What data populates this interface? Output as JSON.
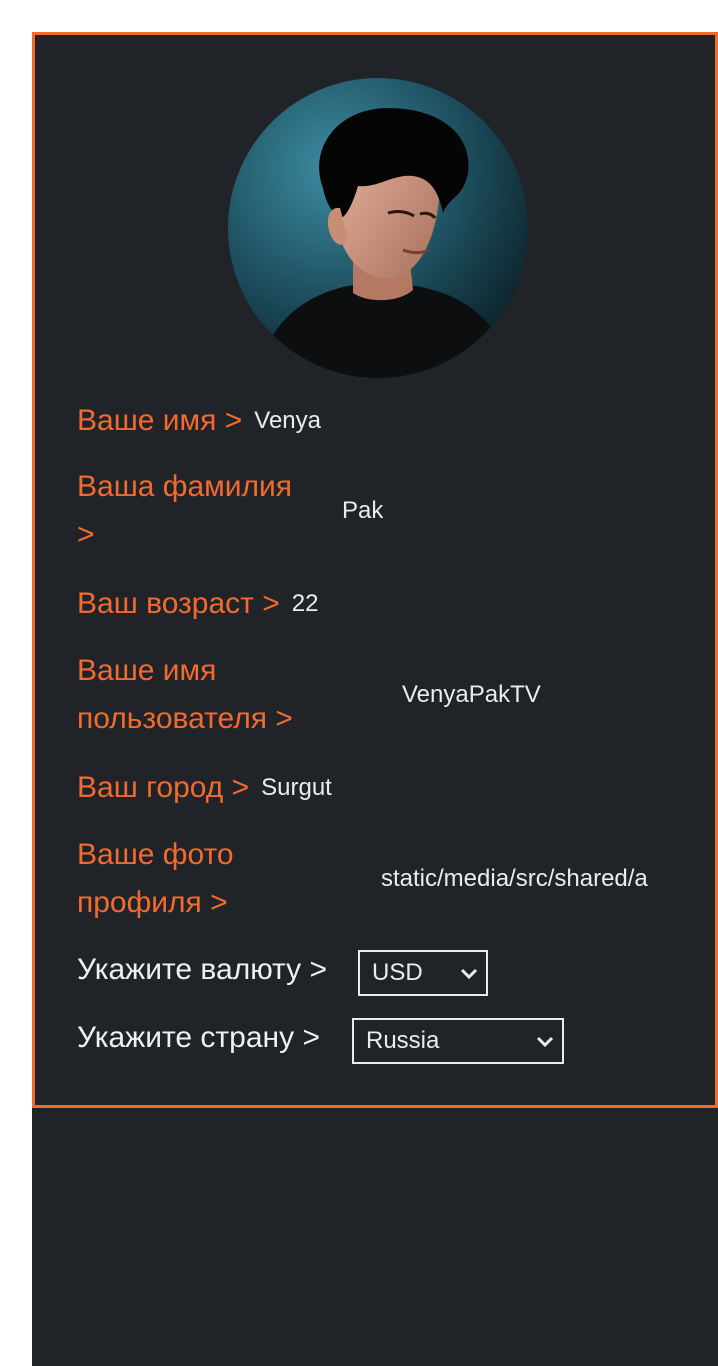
{
  "profile": {
    "avatar_alt": "avatar-illustration",
    "name_label": "Ваше имя >",
    "name_value": "Venya",
    "surname_label_line1": "Ваша фамилия",
    "surname_label_line2": ">",
    "surname_value": "Pak",
    "age_label": "Ваш возраст >",
    "age_value": "22",
    "username_label_line1": "Ваше имя",
    "username_label_line2": "пользователя >",
    "username_value": "VenyaPakTV",
    "city_label": "Ваш город >",
    "city_value": "Surgut",
    "photo_label_line1": "Ваше фото",
    "photo_label_line2": "профиля >",
    "photo_value": "static/media/src/shared/a",
    "currency_label": "Укажите валюту >",
    "currency_selected": "USD",
    "country_label": "Укажите страну >",
    "country_selected": "Russia"
  },
  "colors": {
    "accent": "#f36a2f",
    "background": "#202429",
    "text": "#e9ecef"
  }
}
